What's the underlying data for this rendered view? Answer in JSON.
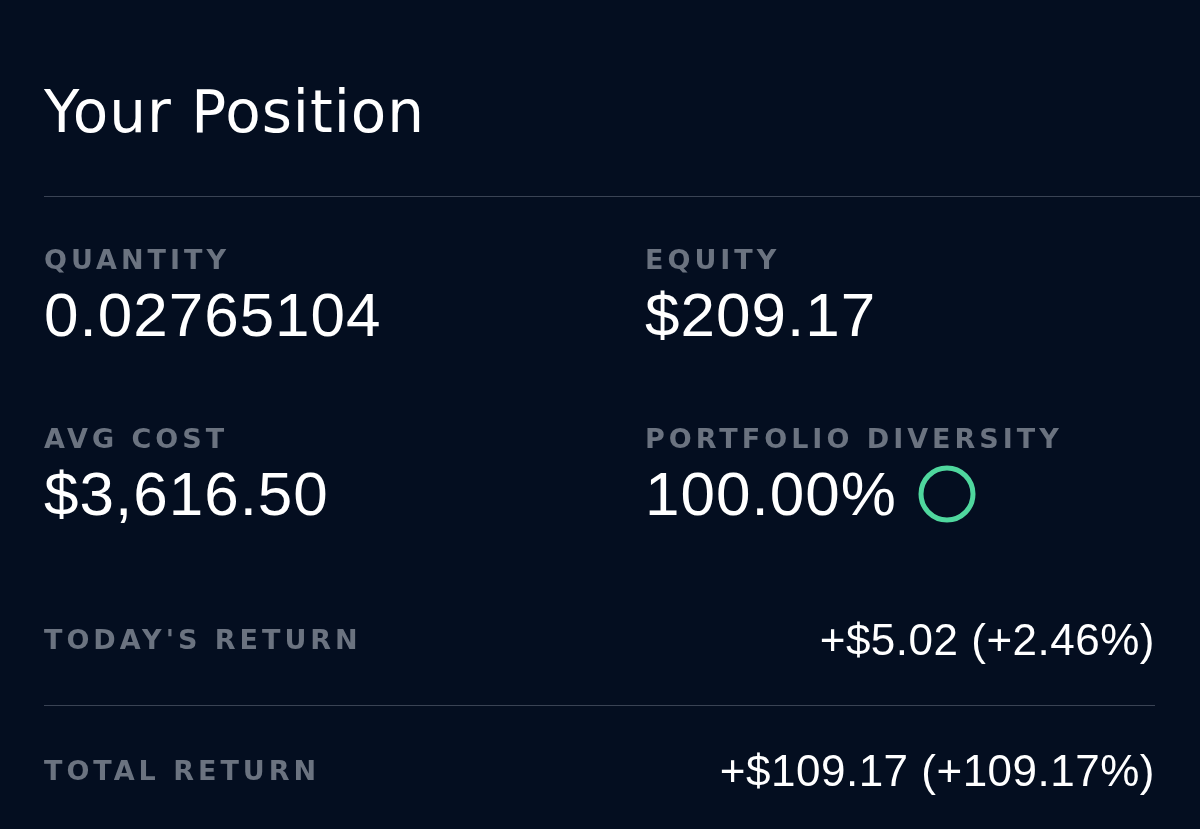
{
  "title": "Your Position",
  "stats": [
    {
      "label": "QUANTITY",
      "value": "0.02765104"
    },
    {
      "label": "EQUITY",
      "value": "$209.17"
    },
    {
      "label": "AVG COST",
      "value": "$3,616.50"
    },
    {
      "label": "PORTFOLIO DIVERSITY",
      "value": "100.00%",
      "ring": true
    }
  ],
  "returns": [
    {
      "label": "TODAY'S RETURN",
      "value": "+$5.02 (+2.46%)"
    },
    {
      "label": "TOTAL RETURN",
      "value": "+$109.17 (+109.17%)"
    }
  ]
}
